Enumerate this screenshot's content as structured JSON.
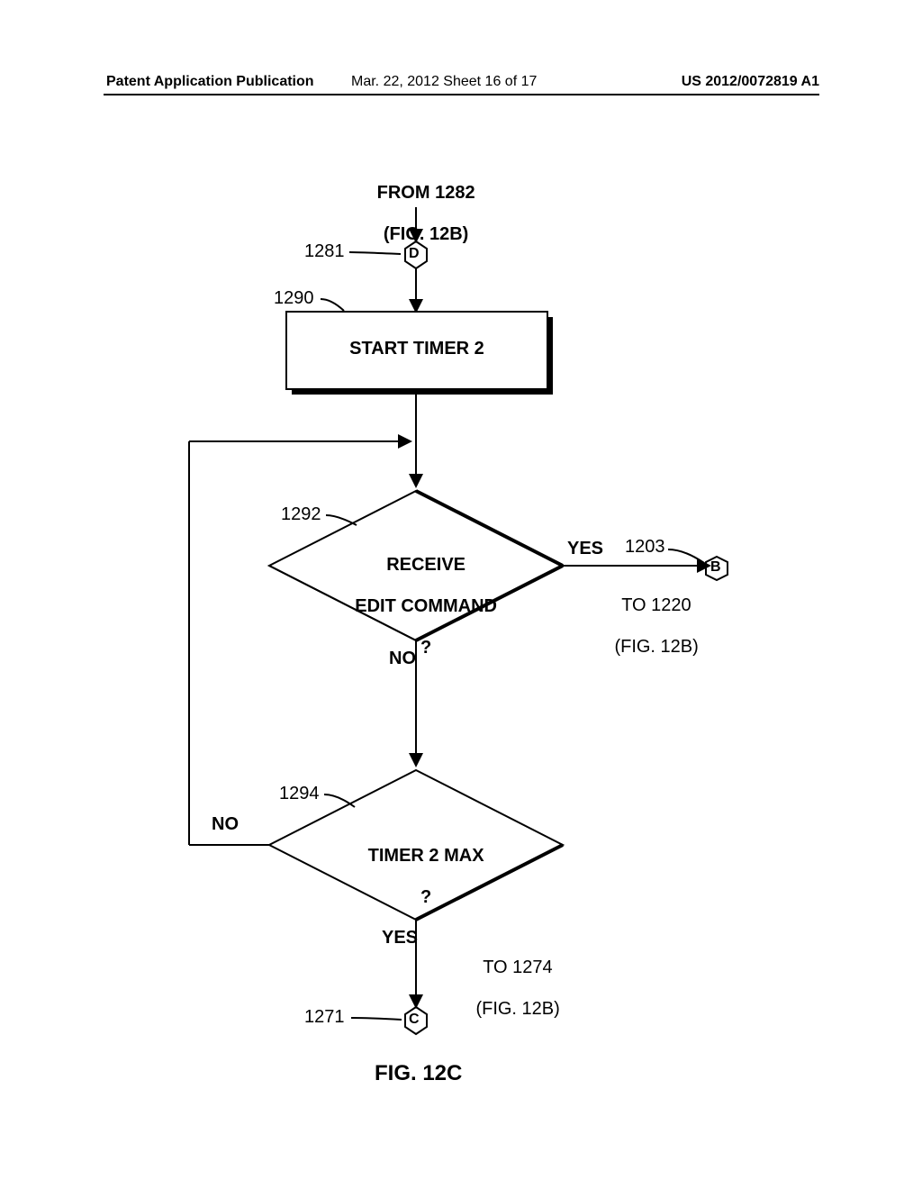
{
  "header": {
    "left": "Patent Application Publication",
    "mid": "Mar. 22, 2012  Sheet 16 of 17",
    "right": "US 2012/0072819 A1"
  },
  "top_entry": {
    "line1": "FROM 1282",
    "line2": "(FIG. 12B)"
  },
  "conn_D": "D",
  "conn_B": "B",
  "conn_C": "C",
  "box1290": "START TIMER 2",
  "dec1292": {
    "line1": "RECEIVE",
    "line2": "EDIT COMMAND",
    "line3": "?"
  },
  "dec1294": {
    "line1": "TIMER 2 MAX",
    "line2": "?"
  },
  "yes": "YES",
  "no": "NO",
  "to1220": {
    "line1": "TO 1220",
    "line2": "(FIG. 12B)"
  },
  "to1274": {
    "line1": "TO 1274",
    "line2": "(FIG. 12B)"
  },
  "ref": {
    "r1281": "1281",
    "r1290": "1290",
    "r1292": "1292",
    "r1203": "1203",
    "r1294": "1294",
    "r1271": "1271"
  },
  "fig": "FIG. 12C"
}
